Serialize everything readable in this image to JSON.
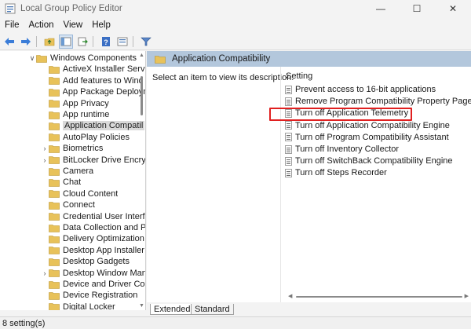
{
  "window": {
    "title": "Local Group Policy Editor",
    "minimize_glyph": "—",
    "maximize_glyph": "☐",
    "close_glyph": "✕"
  },
  "menu": {
    "items": [
      "File",
      "Action",
      "View",
      "Help"
    ]
  },
  "toolbar": {
    "icons": [
      "back-arrow-icon",
      "forward-arrow-icon",
      "up-folder-icon",
      "show-hide-tree-icon",
      "export-list-icon",
      "help-icon",
      "properties-icon",
      "filter-icon"
    ]
  },
  "tree": {
    "items": [
      {
        "label": "Windows Components",
        "expander": "∨",
        "level": 0
      },
      {
        "label": "ActiveX Installer Servi",
        "expander": "",
        "level": 1
      },
      {
        "label": "Add features to Wind",
        "expander": "",
        "level": 1
      },
      {
        "label": "App Package Deploym",
        "expander": "",
        "level": 1
      },
      {
        "label": "App Privacy",
        "expander": "",
        "level": 1
      },
      {
        "label": "App runtime",
        "expander": "",
        "level": 1
      },
      {
        "label": "Application Compatil",
        "expander": "",
        "level": 1,
        "selected": true
      },
      {
        "label": "AutoPlay Policies",
        "expander": "",
        "level": 1
      },
      {
        "label": "Biometrics",
        "expander": "›",
        "level": 1
      },
      {
        "label": "BitLocker Drive Encry",
        "expander": "›",
        "level": 1
      },
      {
        "label": "Camera",
        "expander": "",
        "level": 1
      },
      {
        "label": "Chat",
        "expander": "",
        "level": 1
      },
      {
        "label": "Cloud Content",
        "expander": "",
        "level": 1
      },
      {
        "label": "Connect",
        "expander": "",
        "level": 1
      },
      {
        "label": "Credential User Interf",
        "expander": "",
        "level": 1
      },
      {
        "label": "Data Collection and P",
        "expander": "",
        "level": 1
      },
      {
        "label": "Delivery Optimization",
        "expander": "",
        "level": 1
      },
      {
        "label": "Desktop App Installer",
        "expander": "",
        "level": 1
      },
      {
        "label": "Desktop Gadgets",
        "expander": "",
        "level": 1
      },
      {
        "label": "Desktop Window Man",
        "expander": "›",
        "level": 1
      },
      {
        "label": "Device and Driver Co",
        "expander": "",
        "level": 1
      },
      {
        "label": "Device Registration",
        "expander": "",
        "level": 1
      },
      {
        "label": "Digital Locker",
        "expander": "",
        "level": 1
      }
    ]
  },
  "right_pane": {
    "header_title": "Application Compatibility",
    "description": "Select an item to view its description.",
    "column_header": "Setting",
    "settings": [
      "Prevent access to 16-bit applications",
      "Remove Program Compatibility Property Page",
      "Turn off Application Telemetry",
      "Turn off Application Compatibility Engine",
      "Turn off Program Compatibility Assistant",
      "Turn off Inventory Collector",
      "Turn off SwitchBack Compatibility Engine",
      "Turn off Steps Recorder"
    ],
    "highlighted_setting": "Turn off Application Telemetry"
  },
  "tabs": {
    "extended": "Extended",
    "standard": "Standard"
  },
  "status": {
    "text": "8 setting(s)"
  },
  "colors": {
    "header_bg": "#b3c7dc",
    "highlight_border": "#e02020",
    "folder_fill": "#e8c25a"
  }
}
